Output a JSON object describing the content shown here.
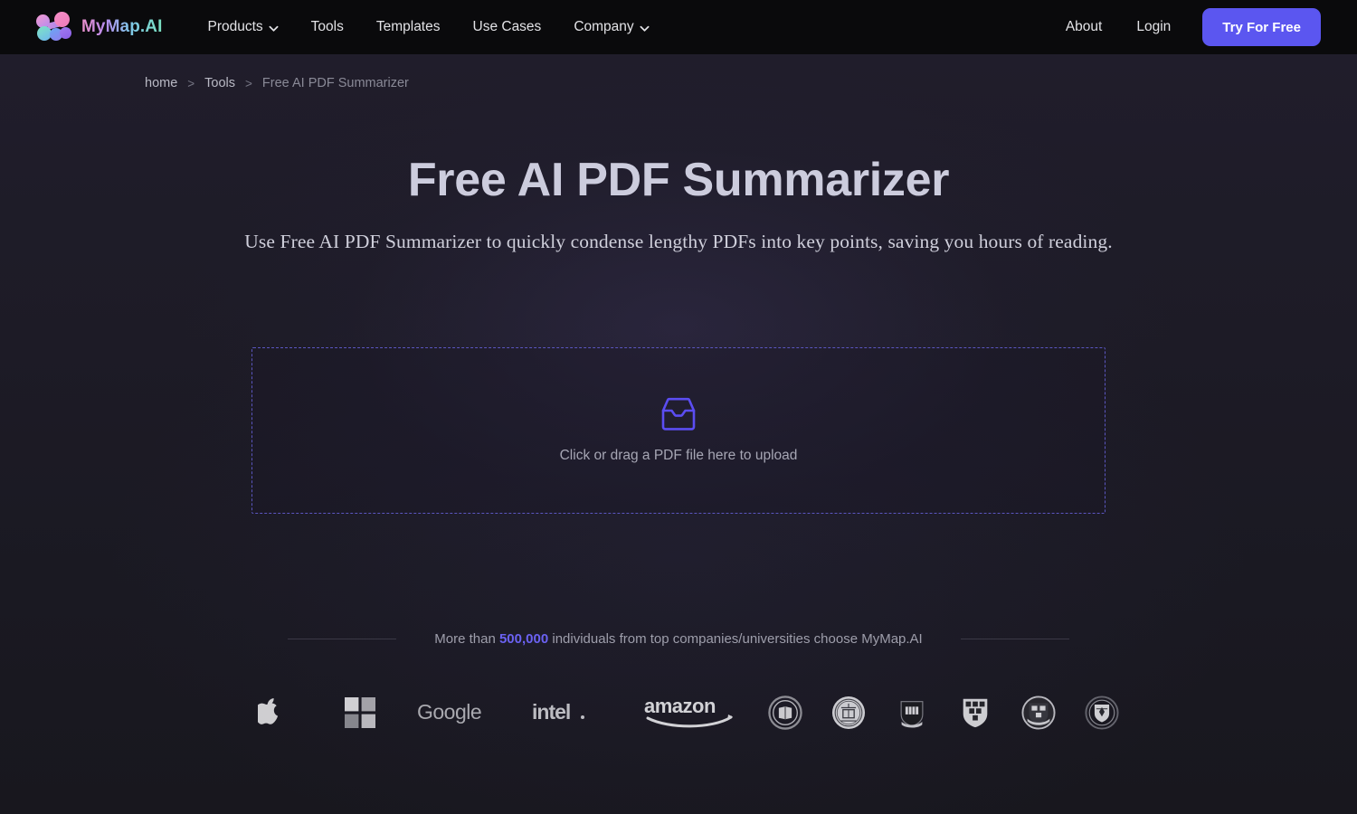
{
  "nav": {
    "brand": "MyMap.AI",
    "links": [
      {
        "label": "Products",
        "has_dropdown": true
      },
      {
        "label": "Tools",
        "has_dropdown": false
      },
      {
        "label": "Templates",
        "has_dropdown": false
      },
      {
        "label": "Use Cases",
        "has_dropdown": false
      },
      {
        "label": "Company",
        "has_dropdown": true
      }
    ],
    "right_links": [
      {
        "label": "About"
      },
      {
        "label": "Login"
      }
    ],
    "cta_label": "Try For Free"
  },
  "breadcrumb": {
    "home": "home",
    "sep1": ">",
    "tools": "Tools",
    "sep2": ">",
    "current": "Free AI PDF Summarizer"
  },
  "hero": {
    "title": "Free AI PDF Summarizer",
    "subtitle": "Use Free AI PDF Summarizer to quickly condense lengthy PDFs into key points, saving you hours of reading."
  },
  "dropzone": {
    "icon": "inbox-tray-icon",
    "label": "Click or drag a PDF file here to upload"
  },
  "social_proof": {
    "prefix": "More than ",
    "count": "500,000",
    "suffix": " individuals from top companies/universities choose MyMap.AI"
  },
  "brand_logos": [
    {
      "name": "apple",
      "label": "Apple"
    },
    {
      "name": "microsoft",
      "label": "Microsoft"
    },
    {
      "name": "google",
      "label": "Google"
    },
    {
      "name": "intel",
      "label": "intel."
    },
    {
      "name": "amazon",
      "label": "amazon"
    },
    {
      "name": "university-seal-1",
      "label": "University Seal"
    },
    {
      "name": "university-seal-2",
      "label": "University Seal"
    },
    {
      "name": "university-seal-3",
      "label": "University Seal"
    },
    {
      "name": "university-seal-4",
      "label": "University Seal"
    },
    {
      "name": "university-seal-5",
      "label": "University Seal"
    },
    {
      "name": "university-seal-6",
      "label": "University Seal"
    }
  ],
  "colors": {
    "page_background": "#1c1a24",
    "navbar_background": "#0a0a0c",
    "accent_purple": "#5b56f0",
    "count_accent": "#6b62f2",
    "dropzone_border": "#5b56c0",
    "heading_text": "#ccccdd"
  }
}
